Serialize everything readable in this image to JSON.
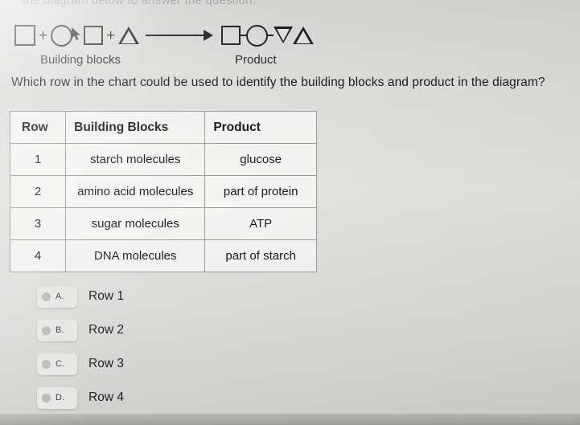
{
  "top_partial_text": "the diagram below to answer the question.",
  "diagram": {
    "reactant_shapes": [
      "square",
      "circle",
      "square-outline",
      "triangle"
    ],
    "product_shapes": [
      "square",
      "circle",
      "triangle-down",
      "triangle-up"
    ],
    "operator": "+",
    "arrow": "reaction-arrow",
    "left_label": "Building blocks",
    "right_label": "Product"
  },
  "question": "Which row in the chart could be used to identify the building blocks and product in the diagram?",
  "table": {
    "headers": [
      "Row",
      "Building Blocks",
      "Product"
    ],
    "rows": [
      [
        "1",
        "starch molecules",
        "glucose"
      ],
      [
        "2",
        "amino acid molecules",
        "part of protein"
      ],
      [
        "3",
        "sugar molecules",
        "ATP"
      ],
      [
        "4",
        "DNA molecules",
        "part of starch"
      ]
    ]
  },
  "options": [
    {
      "letter": "A.",
      "text": "Row 1"
    },
    {
      "letter": "B.",
      "text": "Row 2"
    },
    {
      "letter": "C.",
      "text": "Row 3"
    },
    {
      "letter": "D.",
      "text": "Row 4"
    }
  ]
}
